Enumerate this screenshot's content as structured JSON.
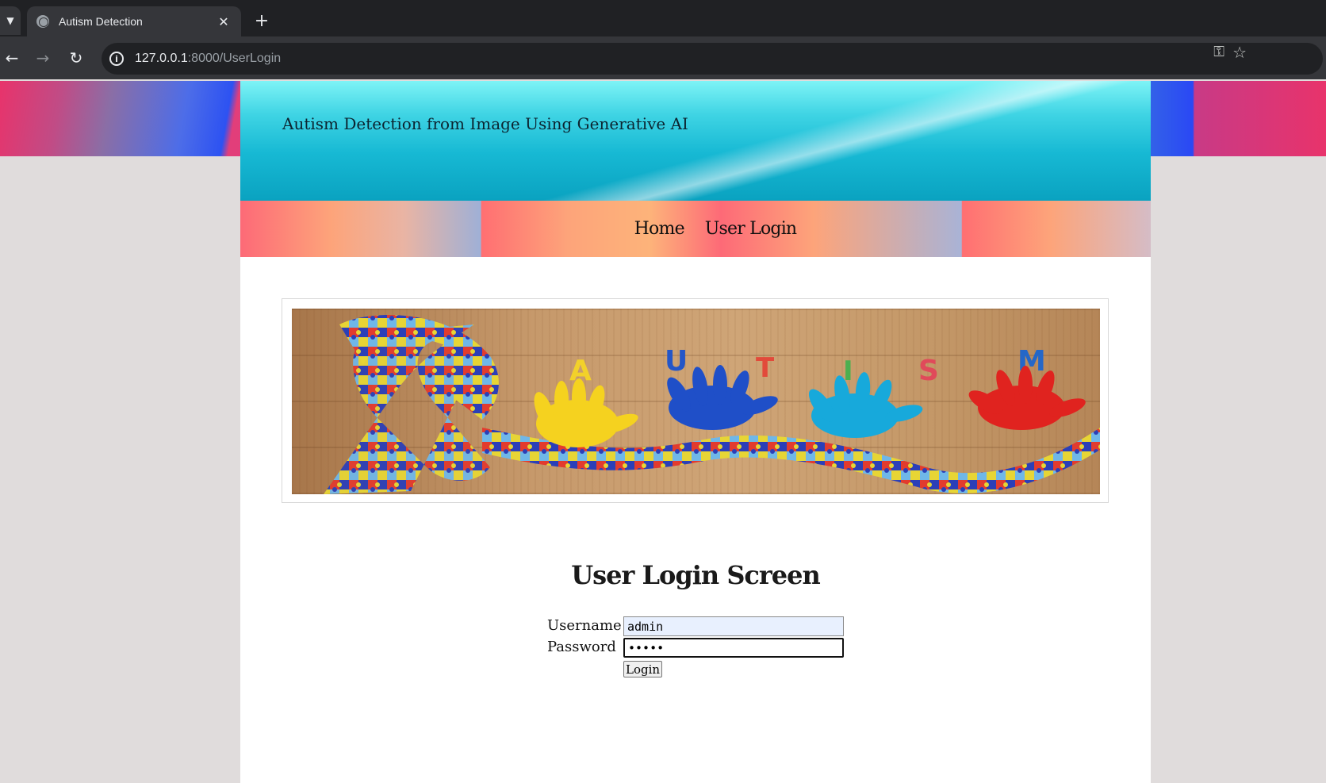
{
  "browser": {
    "tab_title": "Autism Detection",
    "url_host": "127.0.0.1",
    "url_path": ":8000/UserLogin",
    "icons": {
      "tab_menu": "chevron-down-icon",
      "favicon": "globe-icon",
      "close": "close-icon",
      "new_tab": "plus-icon",
      "back": "back-arrow-icon",
      "forward": "forward-arrow-icon",
      "reload": "reload-icon",
      "site_info": "info-icon",
      "password": "key-icon",
      "bookmark": "star-icon"
    }
  },
  "site": {
    "title": "Autism Detection from Image Using Generative AI",
    "nav": [
      {
        "label": "Home"
      },
      {
        "label": "User Login"
      }
    ],
    "banner_image": {
      "letters": [
        "A",
        "U",
        "T",
        "I",
        "S",
        "M"
      ]
    }
  },
  "login": {
    "heading": "User Login Screen",
    "username_label": "Username",
    "username_value": "admin",
    "password_label": "Password",
    "password_value": "•••••",
    "submit_label": "Login"
  },
  "colors": {
    "header_cyan": "#17b9d4",
    "nav_coral": "#fd6a77",
    "page_background": "#e0dcdc",
    "autofill_blue": "#e8f0fe"
  }
}
